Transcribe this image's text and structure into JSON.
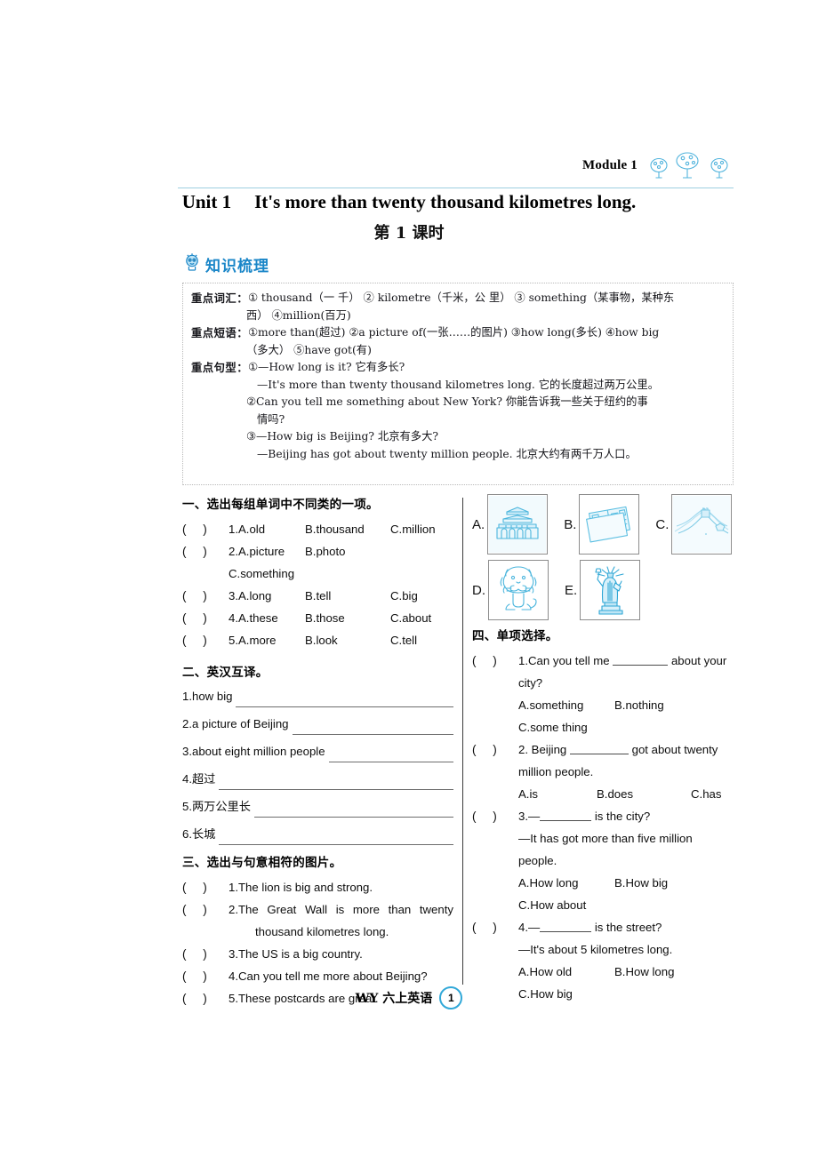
{
  "header": {
    "module_label": "Module 1",
    "trees_icon": "trees-icon"
  },
  "title": {
    "unit_label": "Unit 1",
    "unit_title": "It's more than twenty thousand kilometres long.",
    "lesson": "第 1 课时"
  },
  "knowledge": {
    "badge_icon": "mascot-icon",
    "badge_text": "知识梳理",
    "rows": [
      {
        "label": "重点词汇：",
        "line1": "① thousand（一 千） ② kilometre（千米，公 里） ③ something（某事物，某种东",
        "line2": "西） ④million(百万)"
      },
      {
        "label": "重点短语：",
        "line1": "①more than(超过) ②a picture of(一张……的图片) ③how long(多长) ④how big",
        "line2": "（多大） ⑤have got(有)"
      },
      {
        "label": "重点句型：",
        "line1": "①—How long is it? 它有多长?",
        "line2": "—It's more than twenty thousand kilometres long. 它的长度超过两万公里。",
        "line3": "②Can you tell me something about New York? 你能告诉我一些关于纽约的事",
        "line4": "情吗?",
        "line5": "③—How big is Beijing? 北京有多大?",
        "line6": "—Beijing has got about twenty million people. 北京大约有两千万人口。"
      }
    ]
  },
  "section1": {
    "heading": "一、选出每组单词中不同类的一项。",
    "items": [
      {
        "num": "1.",
        "a": "A.old",
        "b": "B.thousand",
        "c": "C.million"
      },
      {
        "num": "2.",
        "a": "A.picture",
        "b": "B.photo",
        "c": "C.something"
      },
      {
        "num": "3.",
        "a": "A.long",
        "b": "B.tell",
        "c": "C.big"
      },
      {
        "num": "4.",
        "a": "A.these",
        "b": "B.those",
        "c": "C.about"
      },
      {
        "num": "5.",
        "a": "A.more",
        "b": "B.look",
        "c": "C.tell"
      }
    ]
  },
  "section2": {
    "heading": "二、英汉互译。",
    "items": [
      {
        "text": "1.how big"
      },
      {
        "text": "2.a picture of Beijing"
      },
      {
        "text": "3.about eight million people"
      },
      {
        "text": "4.超过"
      },
      {
        "text": "5.两万公里长"
      },
      {
        "text": "6.长城"
      }
    ]
  },
  "section3": {
    "heading": "三、选出与句意相符的图片。",
    "items": [
      {
        "num": "1.",
        "text": "The lion is big and strong.",
        "text2": ""
      },
      {
        "num": "2.",
        "text": "The Great Wall is more than twenty",
        "text2": "thousand kilometres long."
      },
      {
        "num": "3.",
        "text": "The US is a big country.",
        "text2": ""
      },
      {
        "num": "4.",
        "text": "Can you tell me more about Beijing?",
        "text2": ""
      },
      {
        "num": "5.",
        "text": "These postcards are great.",
        "text2": ""
      }
    ]
  },
  "pictures": [
    {
      "label": "A.",
      "icon": "tiananmen-icon"
    },
    {
      "label": "B.",
      "icon": "postcards-icon"
    },
    {
      "label": "C.",
      "icon": "great-wall-icon"
    },
    {
      "label": "D.",
      "icon": "lion-icon"
    },
    {
      "label": "E.",
      "icon": "statue-of-liberty-icon"
    }
  ],
  "section4": {
    "heading": "四、单项选择。",
    "items": [
      {
        "num": "1.",
        "stem_pre": "Can you tell me",
        "stem_post": "about your",
        "stem_cont": "city?",
        "a": "A.something",
        "b": "B.nothing",
        "c": "C.some thing"
      },
      {
        "num": "2.",
        "stem_pre": "Beijing",
        "stem_post": "got about twenty",
        "stem_cont": "million people.",
        "a": "A.is",
        "b": "B.does",
        "c": "C.has"
      },
      {
        "num": "3.",
        "stem_pre": "—",
        "stem_post": "is the city?",
        "stem_cont": "—It has got more than five million",
        "stem_cont2": "people.",
        "a": "A.How long",
        "b": "B.How big",
        "c": "C.How about"
      },
      {
        "num": "4.",
        "stem_pre": "—",
        "stem_post": "is the street?",
        "stem_cont": "—It's about 5 kilometres long.",
        "a": "A.How old",
        "b": "B.How long",
        "c": "C.How big"
      }
    ]
  },
  "footer": {
    "text": "WY 六上英语",
    "page": "1"
  },
  "colors": {
    "accent": "#31a8d8",
    "line": "#9ecfe0",
    "ink": "#111111"
  }
}
